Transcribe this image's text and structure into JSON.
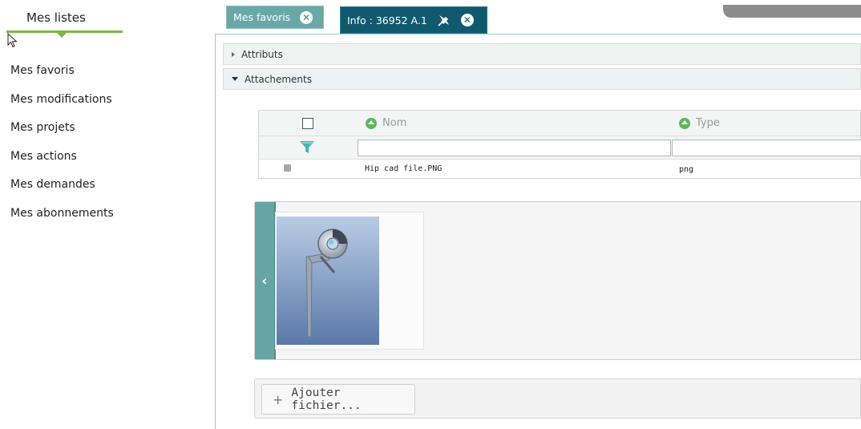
{
  "sidebar": {
    "title": "Mes listes",
    "items": [
      {
        "label": "Mes favoris"
      },
      {
        "label": "Mes modifications"
      },
      {
        "label": "Mes projets"
      },
      {
        "label": "Mes actions"
      },
      {
        "label": "Mes demandes"
      },
      {
        "label": "Mes abonnements"
      }
    ],
    "accent_color": "#7ab648"
  },
  "tabs": [
    {
      "label": "Mes favoris",
      "icon": "close-circle-icon",
      "active": false
    },
    {
      "label": "Info : 36952 A.1",
      "icons": [
        "pin-icon",
        "close-circle-icon"
      ],
      "active": true
    }
  ],
  "sections": {
    "attributes_label": "Attributs",
    "attachments_label": "Attachements"
  },
  "grid": {
    "columns": [
      {
        "label": "Nom",
        "sort_icon": "sort-asc-icon"
      },
      {
        "label": "Type",
        "sort_icon": "sort-asc-icon"
      }
    ],
    "filter_icon": "filter-icon",
    "rows": [
      {
        "name": "Hip cad file.PNG",
        "type": "png"
      }
    ]
  },
  "preview": {
    "collapse_glyph": "‹",
    "thumbnail_icon": "hip-implant-image"
  },
  "actions": {
    "add_file_label": "Ajouter fichier...",
    "add_icon": "+"
  },
  "colors": {
    "tab_active": "#0f5a6e",
    "tab_inactive": "#6aa8a8",
    "panel_accent": "#66a5a5"
  }
}
